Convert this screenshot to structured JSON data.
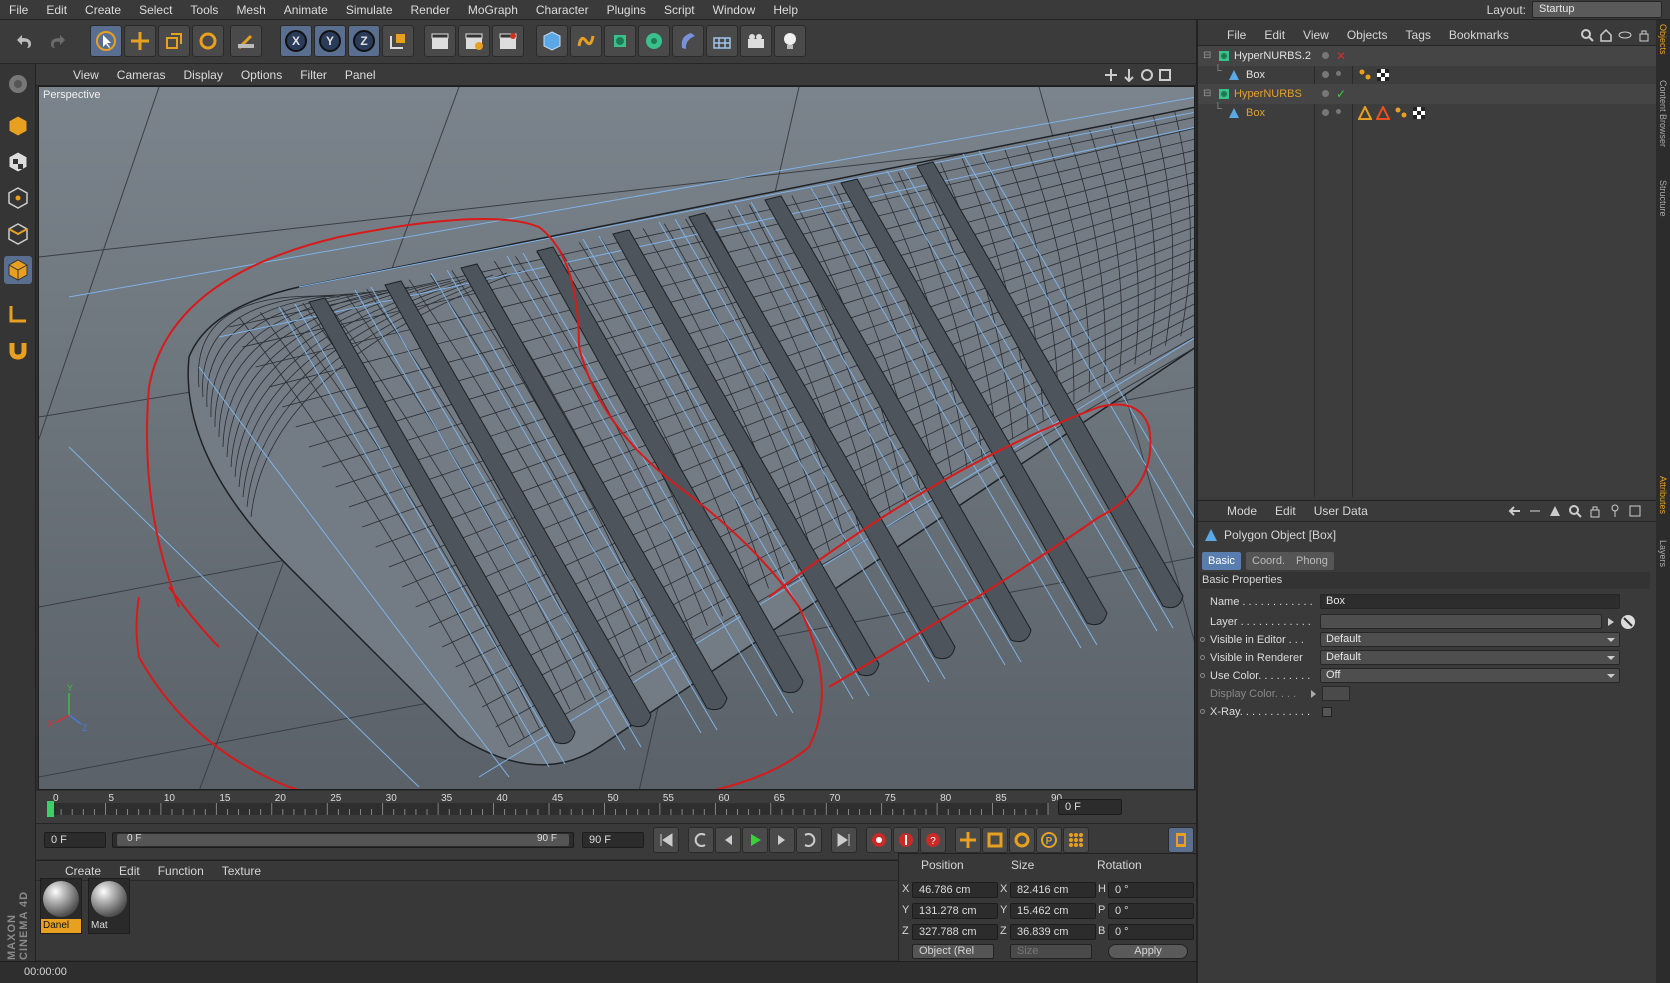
{
  "menubar": {
    "items": [
      "File",
      "Edit",
      "Create",
      "Select",
      "Tools",
      "Mesh",
      "Animate",
      "Simulate",
      "Render",
      "MoGraph",
      "Character",
      "Plugins",
      "Script",
      "Window",
      "Help"
    ],
    "layout_label": "Layout:",
    "layout_value": "Startup"
  },
  "viewport": {
    "menu": [
      "View",
      "Cameras",
      "Display",
      "Options",
      "Filter",
      "Panel"
    ],
    "label": "Perspective"
  },
  "timeline": {
    "ticks": [
      "0",
      "5",
      "10",
      "15",
      "20",
      "25",
      "30",
      "35",
      "40",
      "45",
      "50",
      "55",
      "60",
      "65",
      "70",
      "75",
      "80",
      "85",
      "90"
    ],
    "current_frame": "0 F",
    "start_field": "0 F",
    "range_start": "0 F",
    "range_end": "90 F",
    "end_field": "90 F"
  },
  "material_panel": {
    "menu": [
      "Create",
      "Edit",
      "Function",
      "Texture"
    ],
    "materials": [
      {
        "name": "Danel",
        "selected": true
      },
      {
        "name": "Mat",
        "selected": false
      }
    ]
  },
  "coord_panel": {
    "headers": [
      "Position",
      "Size",
      "Rotation"
    ],
    "rows": [
      {
        "axis": "X",
        "position": "46.786 cm",
        "size_axis": "X",
        "size": "82.416 cm",
        "rot_axis": "H",
        "rotation": "0 °"
      },
      {
        "axis": "Y",
        "position": "131.278 cm",
        "size_axis": "Y",
        "size": "15.462 cm",
        "rot_axis": "P",
        "rotation": "0 °"
      },
      {
        "axis": "Z",
        "position": "327.788 cm",
        "size_axis": "Z",
        "size": "36.839 cm",
        "rot_axis": "B",
        "rotation": "0 °"
      }
    ],
    "mode_select": "Object (Rel",
    "size_select": "Size",
    "apply_label": "Apply"
  },
  "statusbar": {
    "time": "00:00:00"
  },
  "object_manager": {
    "menu": [
      "File",
      "Edit",
      "View",
      "Objects",
      "Tags",
      "Bookmarks"
    ],
    "objects": [
      {
        "name": "HyperNURBS.2",
        "depth": 0,
        "color": "#e0e0e0"
      },
      {
        "name": "Box",
        "depth": 1,
        "color": "#e0e0e0"
      },
      {
        "name": "HyperNURBS",
        "depth": 0,
        "color": "#e2a030"
      },
      {
        "name": "Box",
        "depth": 1,
        "color": "#e2a030"
      }
    ]
  },
  "attribute_manager": {
    "menu": [
      "Mode",
      "Edit",
      "User Data"
    ],
    "title": "Polygon Object [Box]",
    "tabs": [
      "Basic",
      "Coord.",
      "Phong"
    ],
    "section": "Basic Properties",
    "props": [
      {
        "label": "Name . . . . . . . . . . . .",
        "value": "Box"
      },
      {
        "label": "Layer . . . . . . . . . . . .",
        "value": ""
      },
      {
        "label": "Visible in Editor . . .",
        "value": "Default"
      },
      {
        "label": "Visible in Renderer",
        "value": "Default"
      },
      {
        "label": "Use Color. . . . . . . . .",
        "value": "Off"
      },
      {
        "label": "Display Color. . . .",
        "value": ""
      },
      {
        "label": "X-Ray. . . . . . . . . . . .",
        "value": ""
      }
    ]
  },
  "side_tabs": [
    "Objects",
    "Content Browser",
    "Structure",
    "Attributes",
    "Layers"
  ],
  "brand": "MAXON CINEMA 4D",
  "colors": {
    "accent": "#e8a020",
    "annotation": "#d81a1a",
    "wire": "#7fb2e6"
  }
}
